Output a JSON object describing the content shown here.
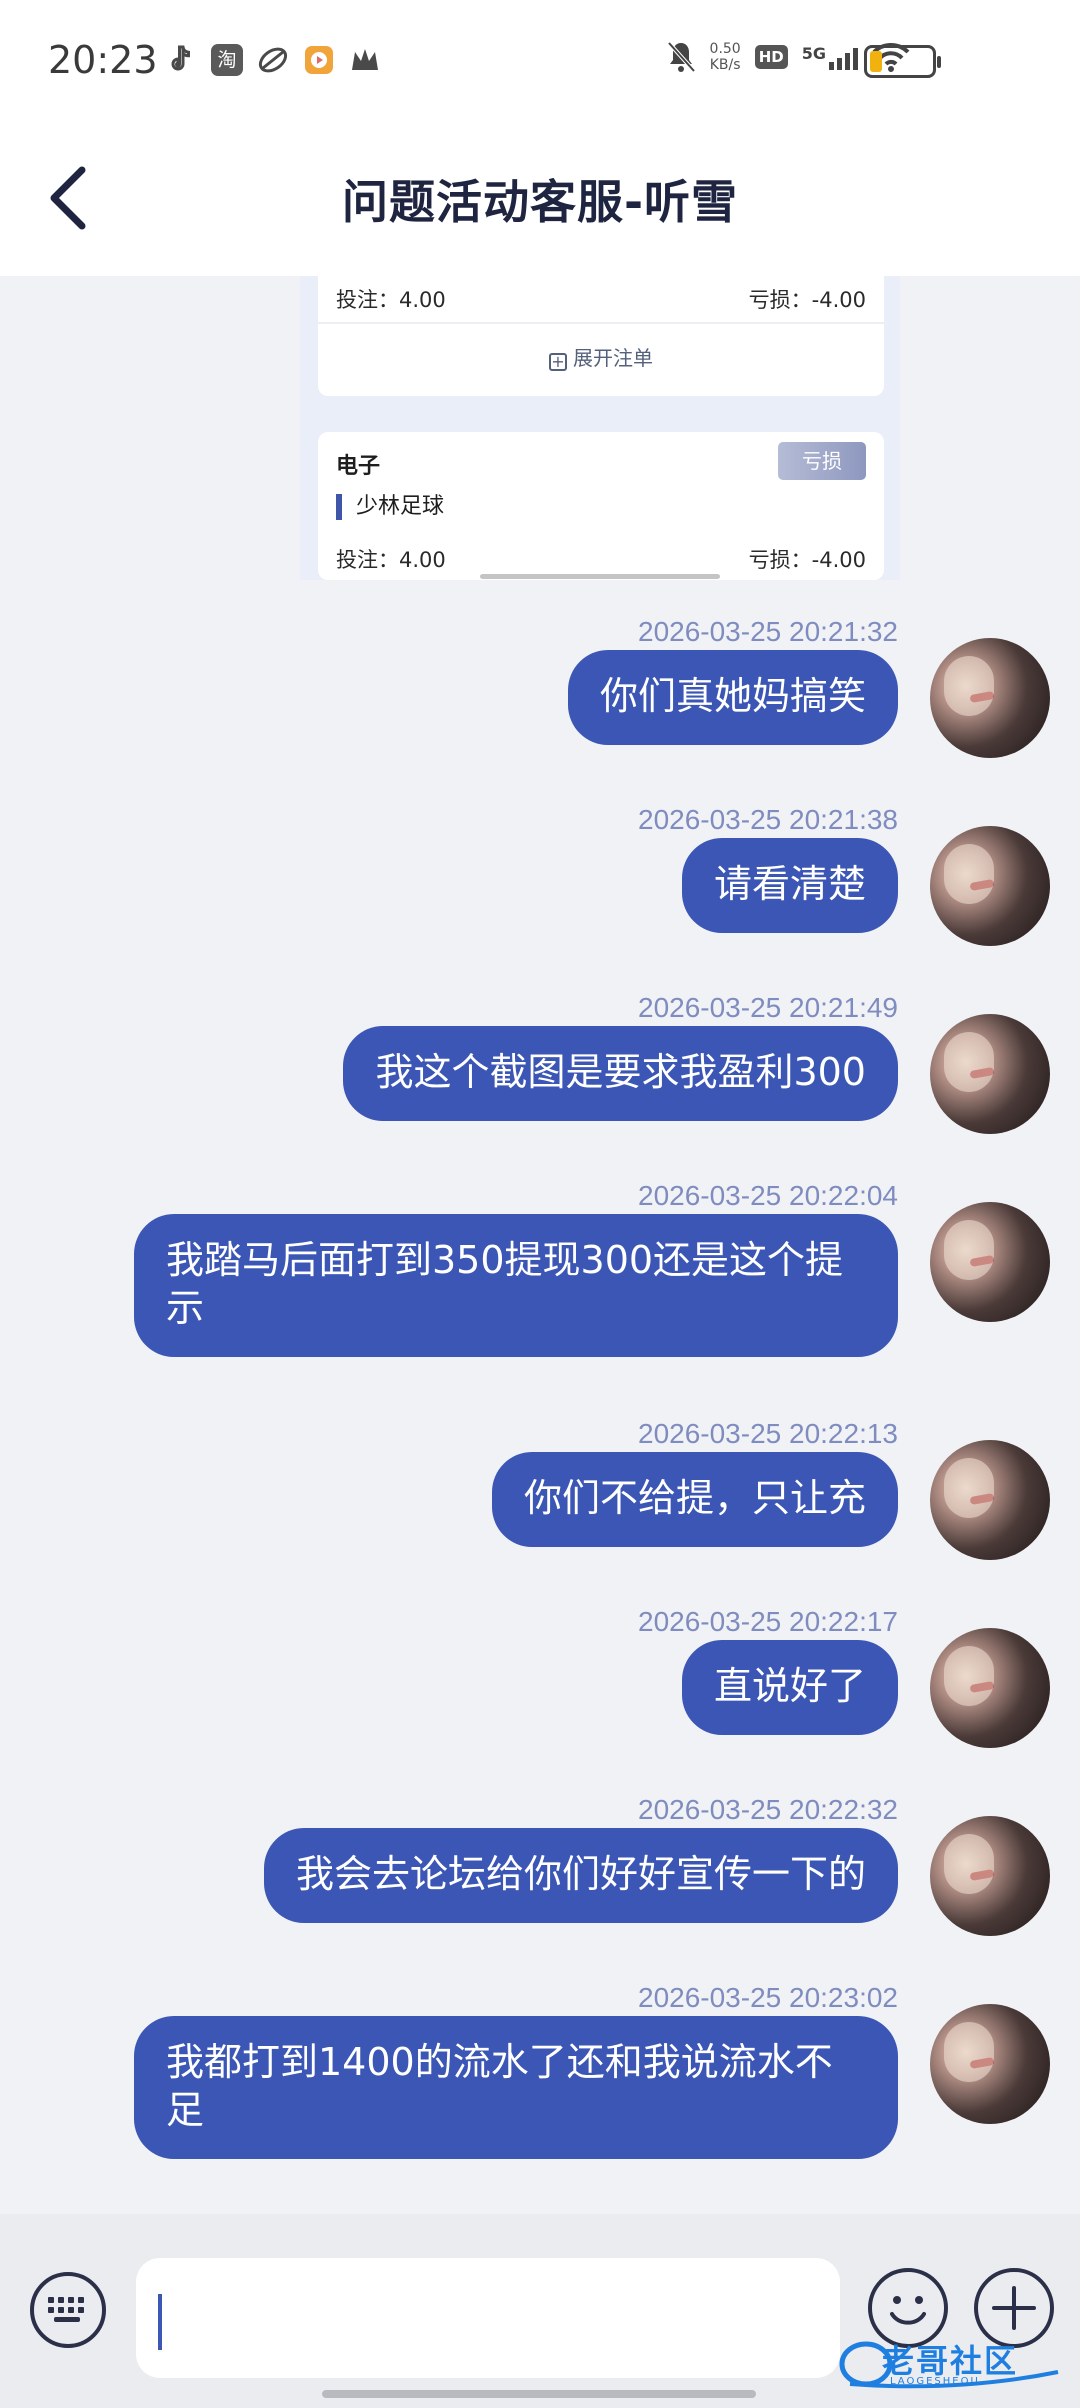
{
  "status_bar": {
    "time": "20:23",
    "app_icons": [
      "tiktok-icon",
      "taobao-icon",
      "app-icon",
      "video-icon",
      "crown-icon"
    ],
    "taobao_glyph": "淘",
    "net_speed_value": "0.50",
    "net_speed_unit": "KB/s",
    "hd_badge": "HD",
    "network": "5G",
    "battery_level": 0.2
  },
  "header": {
    "title": "问题活动客服-听雪"
  },
  "bet_cards": {
    "top_row": {
      "bet_label": "投注：4.00",
      "loss_label": "亏损：-4.00"
    },
    "expand_label": "展开注单",
    "second": {
      "category": "电子",
      "badge": "亏损",
      "game": "少林足球",
      "bet_label": "投注：4.00",
      "loss_label": "亏损：-4.00"
    }
  },
  "messages": [
    {
      "time": "2026-03-25 20:21:32",
      "text": "你们真她妈搞笑"
    },
    {
      "time": "2026-03-25 20:21:38",
      "text": "请看清楚"
    },
    {
      "time": "2026-03-25 20:21:49",
      "text": "我这个截图是要求我盈利300"
    },
    {
      "time": "2026-03-25 20:22:04",
      "text": "我踏马后面打到350提现300还是这个提示"
    },
    {
      "time": "2026-03-25 20:22:13",
      "text": "你们不给提，只让充"
    },
    {
      "time": "2026-03-25 20:22:17",
      "text": "直说好了"
    },
    {
      "time": "2026-03-25 20:22:32",
      "text": "我会去论坛给你们好好宣传一下的"
    },
    {
      "time": "2026-03-25 20:23:02",
      "text": "我都打到1400的流水了还和我说流水不足"
    }
  ],
  "composer": {
    "input_value": "",
    "input_placeholder": ""
  },
  "watermark": {
    "text": "老哥社区",
    "sub": "LAOGESHEQU"
  },
  "colors": {
    "bubble": "#3b56b4",
    "timestamp": "#7f8cbf",
    "background": "#f1f2f6",
    "title": "#1f2540"
  }
}
